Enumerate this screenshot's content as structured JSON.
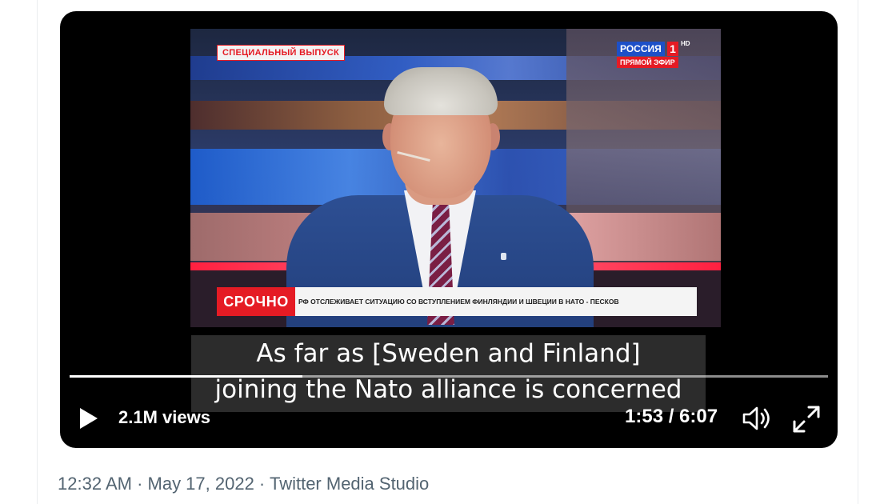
{
  "video": {
    "special_tag": "СПЕЦИАЛЬНЫЙ ВЫПУСК",
    "channel_name": "РОССИЯ",
    "channel_number": "1",
    "channel_hd": "HD",
    "channel_live": "ПРЯМОЙ ЭФИР",
    "breaking_label": "СРОЧНО",
    "breaking_ticker": "РФ ОТСЛЕЖИВАЕТ СИТУАЦИЮ СО ВСТУПЛЕНИЕМ ФИНЛЯНДИИ И ШВЕЦИИ В НАТО - ПЕСКОВ",
    "subtitle_line1": "As far as [Sweden and Finland]",
    "subtitle_line2": "joining the Nato alliance is concerned",
    "progress": 0.307
  },
  "controls": {
    "play_icon": "play-icon",
    "views": "2.1M views",
    "time": "1:53 / 6:07",
    "volume_icon": "volume-icon",
    "fullscreen_icon": "fullscreen-icon"
  },
  "tweet": {
    "meta": "12:32 AM · May 17, 2022 · Twitter Media Studio"
  },
  "colors": {
    "player_bg": "#000000",
    "meta_text": "#536471",
    "breaking_red": "#e51b24",
    "channel_blue": "#1d50c7"
  }
}
